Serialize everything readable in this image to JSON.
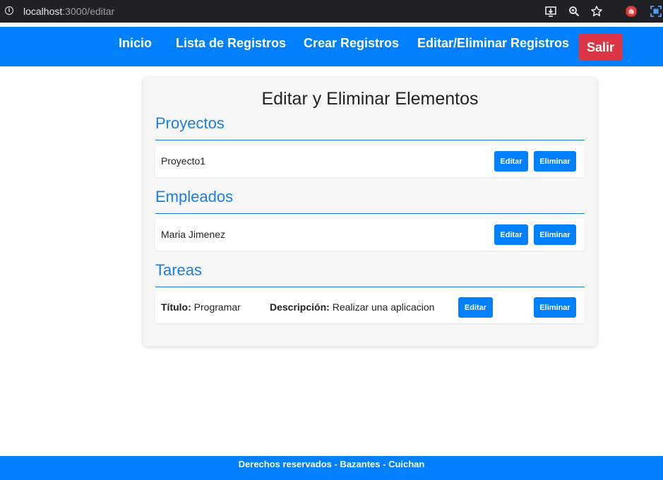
{
  "browser": {
    "url_host": "localhost",
    "url_path": ":3000/editar"
  },
  "nav": {
    "items": [
      {
        "label": "Inicio"
      },
      {
        "label": "Lista de Registros"
      },
      {
        "label": "Crear Registros"
      },
      {
        "label": "Editar/Eliminar Registros"
      }
    ],
    "logout_label": "Salir"
  },
  "main": {
    "title": "Editar y Eliminar Elementos",
    "sections": [
      {
        "heading": "Proyectos",
        "rows": [
          {
            "text": "Proyecto1",
            "edit_label": "Editar",
            "delete_label": "Eliminar"
          }
        ]
      },
      {
        "heading": "Empleados",
        "rows": [
          {
            "text": "Maria Jimenez",
            "edit_label": "Editar",
            "delete_label": "Eliminar"
          }
        ]
      },
      {
        "heading": "Tareas",
        "rows": [
          {
            "title_label": "Título:",
            "title_value": "Programar",
            "desc_label": "Descripción:",
            "desc_value": "Realizar una aplicacion",
            "edit_label": "Editar",
            "delete_label": "Eliminar"
          }
        ]
      }
    ]
  },
  "footer": {
    "text": "Derechos reservados - Bazantes - Cuichan"
  },
  "colors": {
    "primary": "#0080ff",
    "danger": "#dc3545",
    "heading": "#1a7fe0"
  }
}
